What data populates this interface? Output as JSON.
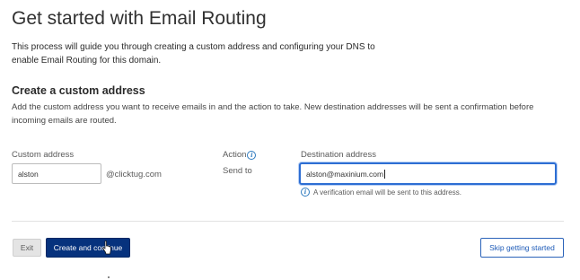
{
  "header": {
    "title": "Get started with Email Routing",
    "intro": "This process will guide you through creating a custom address and configuring your DNS to enable Email Routing for this domain."
  },
  "section": {
    "title": "Create a custom address",
    "description": "Add the custom address you want to receive emails in and the action to take. New destination addresses will be sent a confirmation before incoming emails are routed."
  },
  "form": {
    "custom_address": {
      "label": "Custom address",
      "value": "alston",
      "domain_suffix": "@clicktug.com"
    },
    "action": {
      "label": "Action",
      "value": "Send to",
      "info_icon": "info-circle-icon"
    },
    "destination": {
      "label": "Destination address",
      "value": "alston@maxinium.com",
      "hint": "A verification email will be sent to this address.",
      "hint_icon": "info-circle-icon"
    }
  },
  "footer": {
    "exit_label": "Exit",
    "create_label": "Create and continue",
    "skip_label": "Skip getting started"
  },
  "colors": {
    "primary_button": "#06327d",
    "focus_border": "#2d6ed3",
    "link_blue": "#1e5bb8"
  }
}
